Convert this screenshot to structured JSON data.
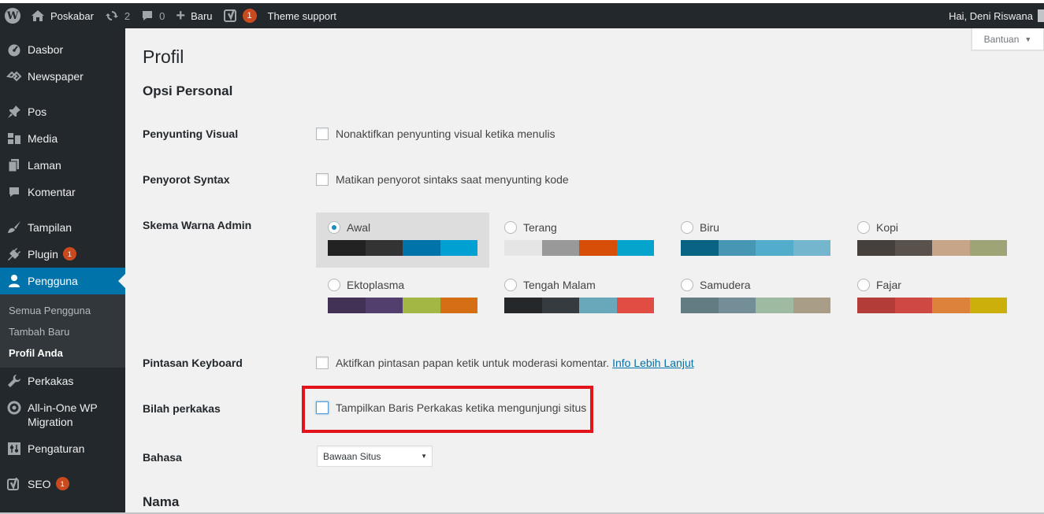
{
  "adminbar": {
    "site_name": "Poskabar",
    "updates_count": "2",
    "comments_count": "0",
    "new_label": "Baru",
    "seo_badge": "1",
    "theme_support": "Theme support",
    "greeting": "Hai, Deni Riswana"
  },
  "help": {
    "label": "Bantuan"
  },
  "sidebar": {
    "items": [
      {
        "label": "Dasbor",
        "icon": "dashboard-icon"
      },
      {
        "label": "Newspaper",
        "icon": "newspaper-icon"
      },
      {
        "label": "Pos",
        "icon": "pin-icon"
      },
      {
        "label": "Media",
        "icon": "media-icon"
      },
      {
        "label": "Laman",
        "icon": "page-icon"
      },
      {
        "label": "Komentar",
        "icon": "comment-icon"
      },
      {
        "label": "Tampilan",
        "icon": "brush-icon"
      },
      {
        "label": "Plugin",
        "icon": "plugin-icon",
        "badge": "1"
      },
      {
        "label": "Pengguna",
        "icon": "user-icon"
      },
      {
        "label": "Perkakas",
        "icon": "wrench-icon"
      },
      {
        "label": "All-in-One WP Migration",
        "icon": "migration-icon"
      },
      {
        "label": "Pengaturan",
        "icon": "settings-icon"
      },
      {
        "label": "SEO",
        "icon": "yoast-icon",
        "badge": "1"
      }
    ],
    "submenu": [
      "Semua Pengguna",
      "Tambah Baru",
      "Profil Anda"
    ]
  },
  "page": {
    "title": "Profil",
    "section_personal": "Opsi Personal",
    "section_name": "Nama",
    "visual_editor": {
      "label": "Penyunting Visual",
      "checkbox": "Nonaktifkan penyunting visual ketika menulis"
    },
    "syntax": {
      "label": "Penyorot Syntax",
      "checkbox": "Matikan penyorot sintaks saat menyunting kode"
    },
    "color_scheme": {
      "label": "Skema Warna Admin"
    },
    "keyboard": {
      "label": "Pintasan Keyboard",
      "checkbox": "Aktifkan pintasan papan ketik untuk moderasi komentar.",
      "link": "Info Lebih Lanjut"
    },
    "toolbar": {
      "label": "Bilah perkakas",
      "checkbox": "Tampilkan Baris Perkakas ketika mengunjungi situs"
    },
    "language": {
      "label": "Bahasa",
      "selected": "Bawaan Situs"
    }
  },
  "schemes": [
    {
      "name": "Awal",
      "colors": [
        "#222222",
        "#333333",
        "#0073aa",
        "#00a0d2"
      ],
      "selected": true
    },
    {
      "name": "Terang",
      "colors": [
        "#e5e5e5",
        "#999999",
        "#d64e07",
        "#04a4cc"
      ]
    },
    {
      "name": "Biru",
      "colors": [
        "#096484",
        "#4796b3",
        "#52accc",
        "#74b6ce"
      ]
    },
    {
      "name": "Kopi",
      "colors": [
        "#46403c",
        "#59524c",
        "#c7a589",
        "#9ea476"
      ]
    },
    {
      "name": "Ektoplasma",
      "colors": [
        "#413256",
        "#523f6d",
        "#a3b745",
        "#d46f15"
      ]
    },
    {
      "name": "Tengah Malam",
      "colors": [
        "#25282b",
        "#363b3f",
        "#69a8bb",
        "#e14d43"
      ]
    },
    {
      "name": "Samudera",
      "colors": [
        "#627c83",
        "#738e96",
        "#9ebaa0",
        "#aa9d88"
      ]
    },
    {
      "name": "Fajar",
      "colors": [
        "#b43c38",
        "#cf4944",
        "#dd823b",
        "#ccaf0b"
      ]
    }
  ]
}
